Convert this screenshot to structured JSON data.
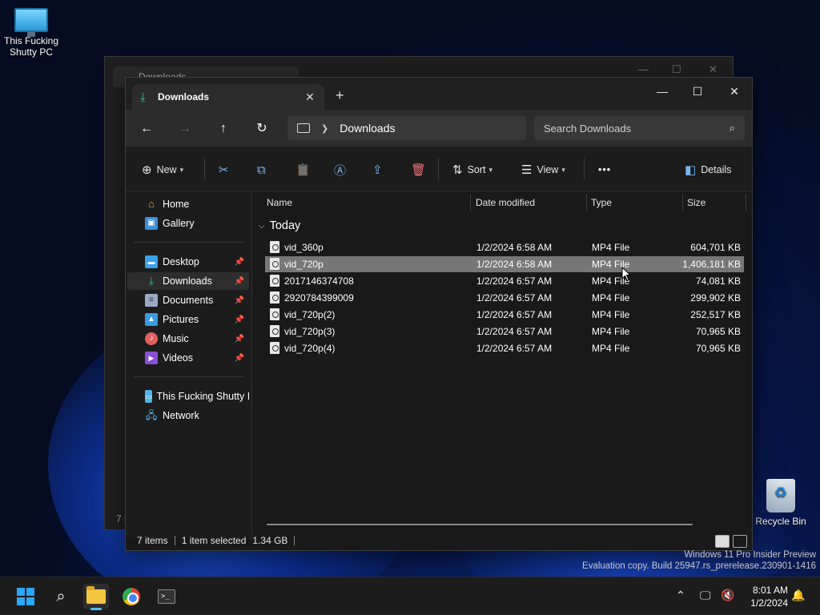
{
  "desktop": {
    "pc_icon_label": "This Fucking Shutty PC",
    "recycle_bin_label": "Recycle Bin"
  },
  "background_window": {
    "tab_title": "Downloads",
    "status_fragment": "7 i"
  },
  "window": {
    "tab_title": "Downloads",
    "address": {
      "location": "Downloads"
    },
    "search": {
      "placeholder": "Search Downloads"
    },
    "toolbar": {
      "new_label": "New",
      "sort_label": "Sort",
      "view_label": "View",
      "more_label": "•••",
      "details_label": "Details"
    },
    "sidebar": {
      "items": [
        {
          "label": "Home",
          "icon": "home-icon",
          "pinned": false
        },
        {
          "label": "Gallery",
          "icon": "gallery-icon",
          "pinned": false
        },
        {
          "label": "Desktop",
          "icon": "desktop-folder-icon",
          "pinned": true
        },
        {
          "label": "Downloads",
          "icon": "download-icon",
          "pinned": true,
          "active": true
        },
        {
          "label": "Documents",
          "icon": "documents-icon",
          "pinned": true
        },
        {
          "label": "Pictures",
          "icon": "pictures-icon",
          "pinned": true
        },
        {
          "label": "Music",
          "icon": "music-icon",
          "pinned": true
        },
        {
          "label": "Videos",
          "icon": "videos-icon",
          "pinned": true
        },
        {
          "label": "This Fucking Shutty I",
          "icon": "this-pc-icon",
          "pinned": false
        },
        {
          "label": "Network",
          "icon": "network-icon",
          "pinned": false
        }
      ]
    },
    "columns": {
      "name": "Name",
      "date": "Date modified",
      "type": "Type",
      "size": "Size"
    },
    "group_label": "Today",
    "files": [
      {
        "name": "vid_360p",
        "date": "1/2/2024 6:58 AM",
        "type": "MP4 File",
        "size": "604,701 KB"
      },
      {
        "name": "vid_720p",
        "date": "1/2/2024 6:58 AM",
        "type": "MP4 File",
        "size": "1,406,181 KB",
        "selected": true
      },
      {
        "name": "2017146374708",
        "date": "1/2/2024 6:57 AM",
        "type": "MP4 File",
        "size": "74,081 KB"
      },
      {
        "name": "2920784399009",
        "date": "1/2/2024 6:57 AM",
        "type": "MP4 File",
        "size": "299,902 KB"
      },
      {
        "name": "vid_720p(2)",
        "date": "1/2/2024 6:57 AM",
        "type": "MP4 File",
        "size": "252,517 KB"
      },
      {
        "name": "vid_720p(3)",
        "date": "1/2/2024 6:57 AM",
        "type": "MP4 File",
        "size": "70,965 KB"
      },
      {
        "name": "vid_720p(4)",
        "date": "1/2/2024 6:57 AM",
        "type": "MP4 File",
        "size": "70,965 KB"
      }
    ],
    "status": {
      "items": "7 items",
      "selected": "1 item selected",
      "selected_size": "1.34 GB"
    }
  },
  "watermark": {
    "line1": "Windows 11 Pro Insider Preview",
    "line2": "Evaluation copy. Build 25947.rs_prerelease.230901-1416"
  },
  "taskbar": {
    "time": "8:01 AM",
    "date": "1/2/2024"
  },
  "colors": {
    "accent": "#4cc2ff",
    "download_green": "#3ec48a",
    "selection": "#777777"
  }
}
